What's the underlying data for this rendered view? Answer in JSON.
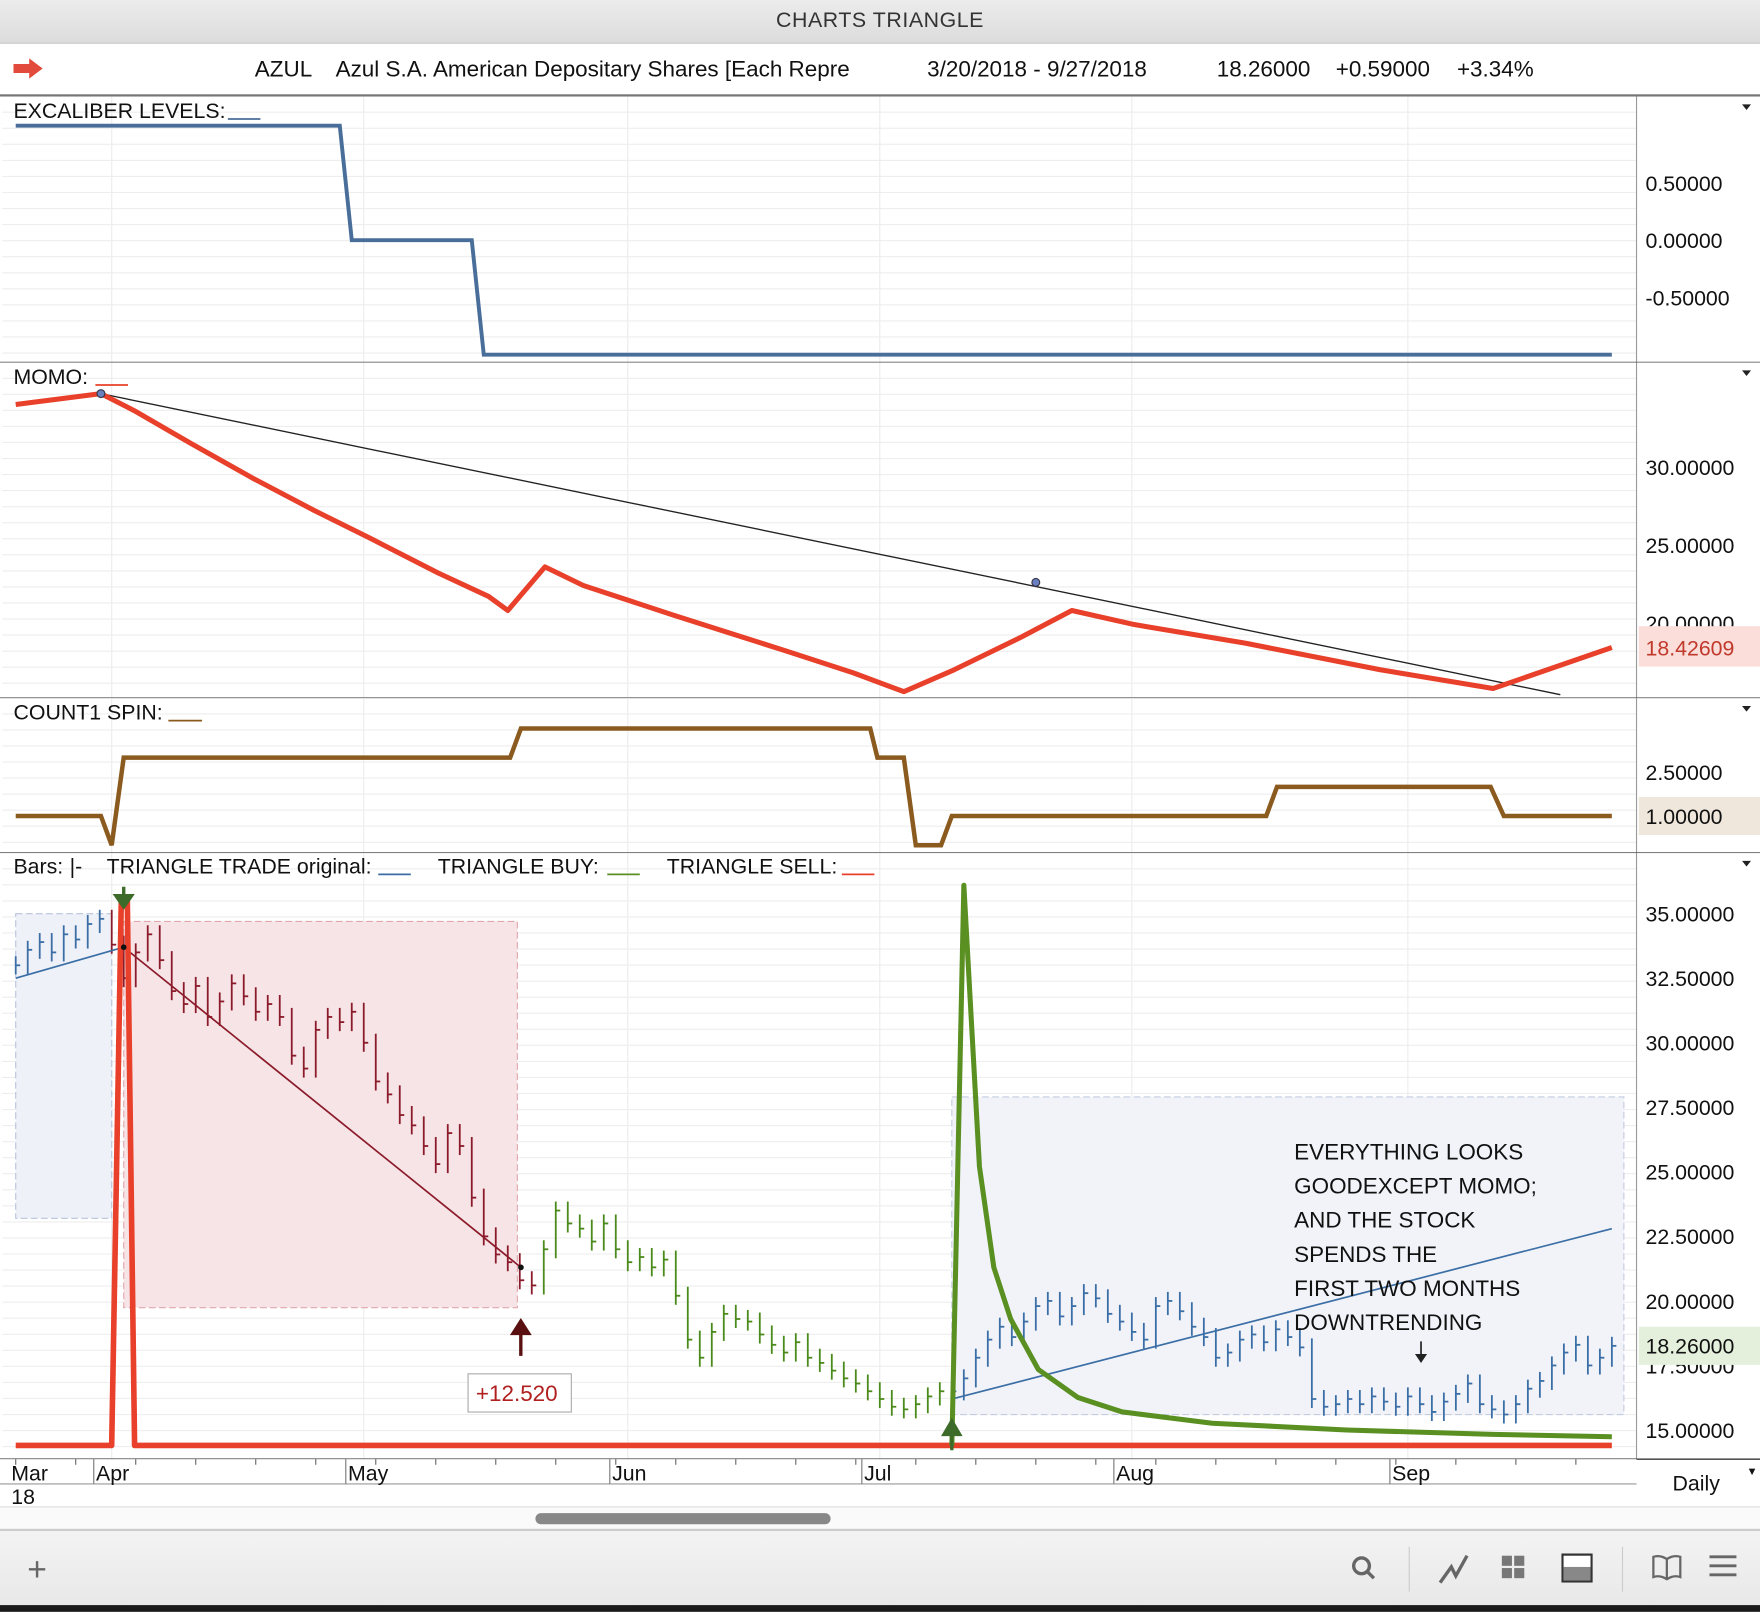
{
  "window": {
    "title": "CHARTS TRIANGLE"
  },
  "header": {
    "symbol": "AZUL",
    "name": "Azul S.A. American Depositary Shares [Each Repre",
    "date_range": "3/20/2018 - 9/27/2018",
    "last": "18.26000",
    "change": "+0.59000",
    "change_pct": "+3.34%"
  },
  "periodicity": "Daily",
  "colors": {
    "excaliber": "#4a6e9a",
    "momo": "#e8402a",
    "count1": "#8b5a1e",
    "buy": "#5a8f22",
    "sell": "#e8402a",
    "bars_blue": "#3a6ea5",
    "bars_red": "#8b1a2a",
    "bars_green": "#4a8a1a",
    "trend": "#222222"
  },
  "chart_data": [
    {
      "type": "line",
      "title": "EXCALIBER LEVELS:",
      "ylim": [
        -1.05,
        1.0
      ],
      "yticks": [
        0.5,
        0,
        -0.5
      ],
      "x": [
        0,
        27,
        28,
        38,
        39,
        133
      ],
      "values": [
        1,
        1,
        0,
        0,
        -1,
        -1
      ]
    },
    {
      "type": "line",
      "title": "MOMO:",
      "ylim": [
        15,
        35
      ],
      "yticks": [
        30,
        25,
        20
      ],
      "last_value_label": "18.42609",
      "last_value": 18.42609,
      "x": [
        0,
        7.1,
        9.9,
        14.6,
        19.7,
        24.9,
        29.6,
        35.2,
        39.4,
        41.0,
        44.1,
        47.3,
        54.8,
        64.2,
        69.8,
        74.0,
        78.2,
        83.8,
        88.0,
        93.2,
        102.5,
        113.7,
        123.1,
        133
      ],
      "values": [
        34.0,
        34.7,
        33.6,
        31.5,
        29.3,
        27.2,
        25.4,
        23.2,
        21.7,
        20.8,
        23.6,
        22.4,
        20.5,
        18.2,
        16.8,
        15.6,
        17.0,
        19.1,
        20.8,
        19.9,
        18.7,
        17.0,
        15.8,
        18.42609
      ],
      "trendline": {
        "x": [
          7.1,
          128.7
        ],
        "values": [
          34.7,
          15.4
        ]
      },
      "pivots": [
        {
          "x": 7.1,
          "value": 34.7
        },
        {
          "x": 85.0,
          "value": 22.6
        }
      ]
    },
    {
      "type": "line",
      "title": "COUNT1 SPIN:",
      "yticks": [
        2.5
      ],
      "last_value_label": "1.00000",
      "last_value": 1,
      "x": [
        0,
        7.1,
        8.0,
        9.0,
        41.2,
        42.1,
        71.2,
        71.8,
        74.0,
        75.0,
        77.1,
        78.0,
        104.2,
        105.1,
        122.9,
        124.0,
        133
      ],
      "values": [
        1,
        1,
        0,
        3,
        3,
        4,
        4,
        3,
        3,
        0,
        0,
        1,
        1,
        2,
        2,
        1,
        1
      ]
    },
    {
      "type": "bar",
      "title": "Bars:",
      "legend": [
        {
          "label": "TRIANGLE TRADE original:",
          "color": "#3a6ea5"
        },
        {
          "label": "TRIANGLE BUY:",
          "color": "#5a8f22"
        },
        {
          "label": "TRIANGLE SELL:",
          "color": "#e8402a"
        }
      ],
      "bars_label": "Bars:",
      "bars_symbol": "|-",
      "ylim": [
        14,
        36.5
      ],
      "yticks": [
        35,
        32.5,
        30,
        27.5,
        25,
        22.5,
        20,
        17.5,
        15
      ],
      "last_value_label": "18.26000",
      "last_value": 18.26,
      "x_labels": [
        {
          "x": 0,
          "label": "Mar",
          "sub": "18"
        },
        {
          "x": 8,
          "label": "Apr"
        },
        {
          "x": 29,
          "label": "May"
        },
        {
          "x": 51,
          "label": "Jun"
        },
        {
          "x": 72,
          "label": "Jul"
        },
        {
          "x": 93,
          "label": "Aug"
        },
        {
          "x": 116,
          "label": "Sep"
        }
      ],
      "closes": [
        33.0,
        33.6,
        33.9,
        33.5,
        34.2,
        34.0,
        34.6,
        34.8,
        33.8,
        32.5,
        33.5,
        34.2,
        33.2,
        32.0,
        31.5,
        32.2,
        31.0,
        31.6,
        32.3,
        31.8,
        31.2,
        31.5,
        31.0,
        29.5,
        29.0,
        30.5,
        31.0,
        30.8,
        31.2,
        30.0,
        28.5,
        28.0,
        27.2,
        26.8,
        26.0,
        25.3,
        26.5,
        26.0,
        24.0,
        22.5,
        21.8,
        21.5,
        20.8,
        20.6,
        22.0,
        23.5,
        23.0,
        22.8,
        22.3,
        23.0,
        22.0,
        21.5,
        21.7,
        21.3,
        21.6,
        20.2,
        18.5,
        17.8,
        18.8,
        19.5,
        19.3,
        19.2,
        18.7,
        18.3,
        18.0,
        18.4,
        17.8,
        17.6,
        17.3,
        17.0,
        16.8,
        16.5,
        16.2,
        15.9,
        15.8,
        16.0,
        16.3,
        16.5,
        16.5,
        17.0,
        17.8,
        18.5,
        19.0,
        18.6,
        19.2,
        19.8,
        20.0,
        19.4,
        19.8,
        20.3,
        20.1,
        19.5,
        19.2,
        18.8,
        18.5,
        19.8,
        20.0,
        19.6,
        19.0,
        18.6,
        17.8,
        18.0,
        18.5,
        18.7,
        18.4,
        18.9,
        18.6,
        18.2,
        16.2,
        15.9,
        16.0,
        16.2,
        16.0,
        16.3,
        16.1,
        15.9,
        16.3,
        16.0,
        15.7,
        16.1,
        16.4,
        16.8,
        16.0,
        15.8,
        15.6,
        16.0,
        16.6,
        16.9,
        17.5,
        18.0,
        18.3,
        17.5,
        17.8,
        18.26
      ],
      "bar_color_segments": [
        {
          "from": 0,
          "to": 7,
          "color": "bars_blue"
        },
        {
          "from": 8,
          "to": 43,
          "color": "bars_red"
        },
        {
          "from": 44,
          "to": 77,
          "color": "bars_green"
        },
        {
          "from": 78,
          "to": 133,
          "color": "bars_blue"
        }
      ],
      "lines": [
        {
          "name": "triangle-trade-ma-start",
          "color": "#3a6ea5",
          "x": [
            0,
            9
          ],
          "values": [
            32.5,
            33.7
          ]
        },
        {
          "name": "triangle-trade-down-line",
          "color": "#8b1a2a",
          "x": [
            9,
            42.1
          ],
          "values": [
            33.7,
            21.3
          ]
        },
        {
          "name": "triangle-trade-ma-end",
          "color": "#3a6ea5",
          "x": [
            78,
            133
          ],
          "values": [
            16.2,
            22.8
          ]
        }
      ],
      "buy": {
        "x": [
          0,
          78.0,
          79.0,
          80.3,
          81.5,
          82.9,
          85.2,
          88.5,
          92.2,
          99.7,
          110.9,
          123.1,
          133
        ],
        "values": [
          null,
          14.39,
          36.1,
          25.2,
          21.3,
          19.3,
          17.35,
          16.26,
          15.7,
          15.26,
          15.0,
          14.83,
          14.74
        ]
      },
      "sell": {
        "x": [
          0,
          8.0,
          8.8,
          9.3,
          9.9,
          133
        ],
        "values": [
          14.4,
          14.4,
          35.6,
          35.6,
          14.4,
          14.4
        ]
      },
      "boxes": [
        {
          "name": "pre-trade-zone",
          "x": [
            0,
            8
          ],
          "values": [
            35,
            23.2
          ],
          "fill": "#eef1f8",
          "stroke": "#b8c4dc"
        },
        {
          "name": "sell-zone",
          "x": [
            9,
            41.8
          ],
          "values": [
            34.7,
            19.74
          ],
          "fill": "#f6e4e6",
          "stroke": "#e0a8ad"
        },
        {
          "name": "buy-zone",
          "x": [
            78,
            134
          ],
          "values": [
            27.9,
            15.6
          ],
          "fill": "#f1f3f9",
          "stroke": "#c4cce0"
        }
      ],
      "trade_label": "+12.520",
      "annotation": [
        "EVERYTHING LOOKS",
        "GOODEXCEPT MOMO;",
        "AND THE STOCK",
        "SPENDS THE",
        "FIRST TWO MONTHS",
        "DOWNTRENDING"
      ]
    }
  ]
}
